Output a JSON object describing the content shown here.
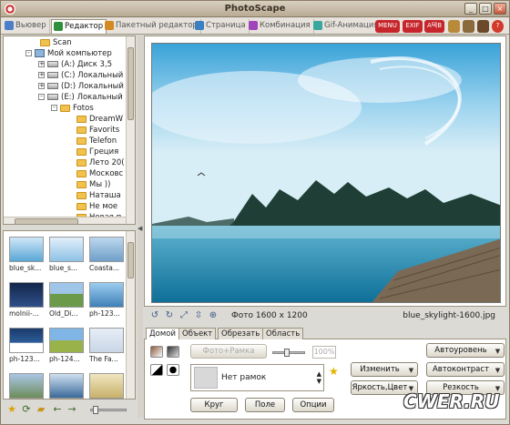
{
  "window": {
    "title": "PhotoScape"
  },
  "tabs": [
    {
      "label": "Вьювер",
      "color": "#4c7ec9"
    },
    {
      "label": "Редактор",
      "color": "#2f8f3a"
    },
    {
      "label": "Пакетный редактор",
      "color": "#d28a22"
    },
    {
      "label": "Страница",
      "color": "#3a7fc1"
    },
    {
      "label": "Комбинация",
      "color": "#a046b8"
    },
    {
      "label": "Gif-Анимация",
      "color": "#3aa6a0"
    }
  ],
  "toolbar_right": {
    "menu": "MENU",
    "exif": "EXIF",
    "abc": "A텍B"
  },
  "tree": [
    {
      "label": "Scan",
      "kind": "folder",
      "expander": ""
    },
    {
      "label": "Мой компьютер",
      "kind": "pc",
      "expander": "-"
    },
    {
      "label": "(A:) Диск 3,5",
      "kind": "drive",
      "expander": "+"
    },
    {
      "label": "(C:) Локальный",
      "kind": "drive",
      "expander": "+"
    },
    {
      "label": "(D:) Локальный",
      "kind": "drive",
      "expander": "+"
    },
    {
      "label": "(E:) Локальный",
      "kind": "drive",
      "expander": "-"
    },
    {
      "label": "Fotos",
      "kind": "folder",
      "expander": "-"
    },
    {
      "label": "DreamW",
      "kind": "folder",
      "expander": ""
    },
    {
      "label": "Favorits",
      "kind": "folder",
      "expander": ""
    },
    {
      "label": "Telefon",
      "kind": "folder",
      "expander": ""
    },
    {
      "label": "Греция",
      "kind": "folder",
      "expander": ""
    },
    {
      "label": "Лето 20(",
      "kind": "folder",
      "expander": ""
    },
    {
      "label": "Московс",
      "kind": "folder",
      "expander": ""
    },
    {
      "label": "Мы ))",
      "kind": "folder",
      "expander": ""
    },
    {
      "label": "Наташа",
      "kind": "folder",
      "expander": ""
    },
    {
      "label": "Не мое",
      "kind": "folder",
      "expander": ""
    },
    {
      "label": "Новая п",
      "kind": "folder",
      "expander": ""
    }
  ],
  "thumbnails": [
    {
      "label": "blue_sk...",
      "color": "#5aa7d6"
    },
    {
      "label": "blue_s...",
      "color": "#8ec2e6"
    },
    {
      "label": "Coasta...",
      "color": "#6f9fc8"
    },
    {
      "label": "molnii-...",
      "color": "#2f4f8a"
    },
    {
      "label": "Old_Di...",
      "color": "#6a9a4a"
    },
    {
      "label": "ph-123...",
      "color": "#3f7fb8"
    },
    {
      "label": "ph-123...",
      "color": "#2d5d9a"
    },
    {
      "label": "ph-124...",
      "color": "#9ab24a"
    },
    {
      "label": "The Fa...",
      "color": "#c9d6e6"
    },
    {
      "label": "",
      "color": "#6c8c5a"
    },
    {
      "label": "",
      "color": "#3a6a9a"
    },
    {
      "label": "",
      "color": "#c7b06a"
    }
  ],
  "view": {
    "photo_info": "Фото 1600 x 1200",
    "file_name": "blue_skylight-1600.jpg"
  },
  "edit_tabs": [
    "Домой",
    "Объект",
    "Обрезать",
    "Область"
  ],
  "home_panel": {
    "photo_frame_btn": "Фото+Рамка",
    "percent": "100%",
    "frame_label": "Нет рамок",
    "circle_btn": "Круг",
    "field_btn": "Поле",
    "options_btn": "Опции",
    "resize_btn": "Изменить",
    "brightness_btn": "Яркость,Цвет",
    "autolevel_btn": "Автоуровень",
    "autocontrast_btn": "Автоконтраст",
    "sharpen_btn": "Резкость"
  },
  "watermark": "CWER.RU"
}
